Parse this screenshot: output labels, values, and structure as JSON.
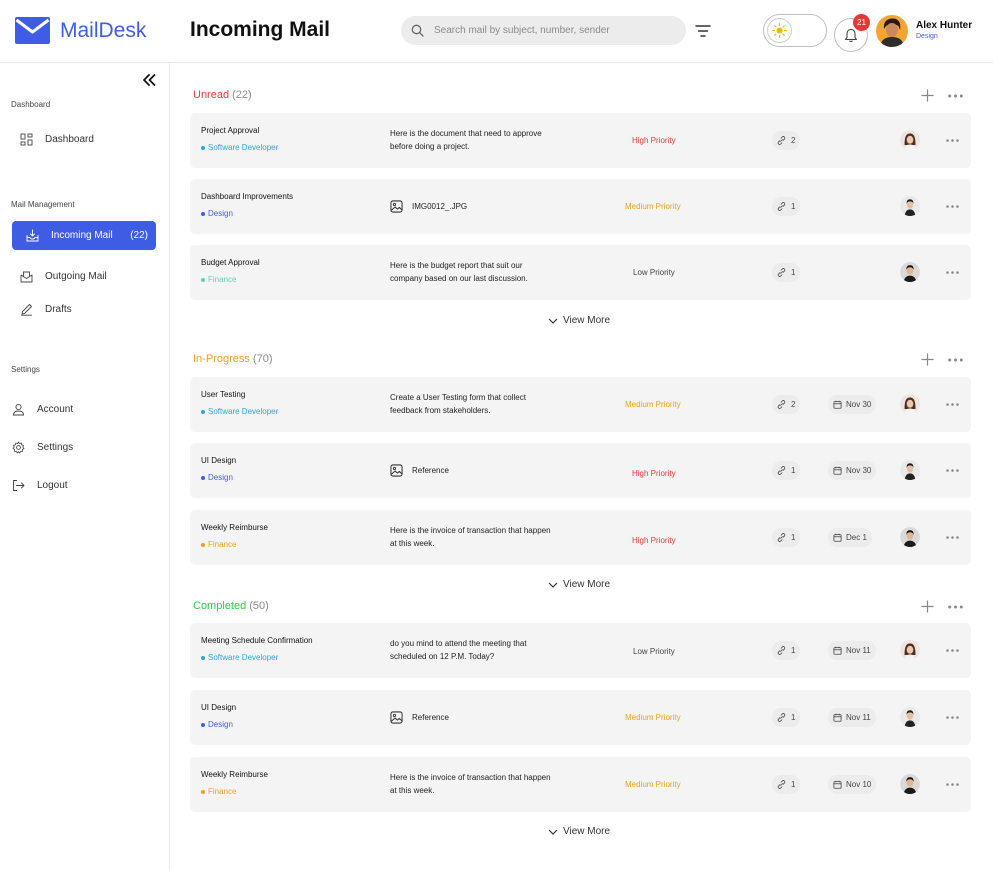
{
  "app": {
    "name": "MailDesk"
  },
  "header": {
    "title": "Incoming Mail",
    "search_placeholder": "Search mail by subject, number, sender",
    "notifications": "21",
    "user": {
      "name": "Alex Hunter",
      "role": "Design"
    }
  },
  "sidebar": {
    "sections": [
      {
        "label": "Dashboard"
      },
      {
        "label": "Mail Management"
      },
      {
        "label": "Settings"
      }
    ],
    "items": [
      {
        "label": "Dashboard"
      },
      {
        "label": "Incoming Mail",
        "count": "(22)"
      },
      {
        "label": "Outgoing Mail"
      },
      {
        "label": "Drafts"
      },
      {
        "label": "Account"
      },
      {
        "label": "Settings"
      },
      {
        "label": "Logout"
      }
    ]
  },
  "colors": {
    "accent": "#3f5de4",
    "unread": "#e53935",
    "in_progress": "#f0a020",
    "completed": "#2ecc40",
    "high_priority": "#e53935",
    "medium_priority": "#e8a317",
    "low_priority": "#444444",
    "tag_software": "#29a8e0",
    "tag_design": "#3f5de4",
    "tag_finance": "#f0a020",
    "tag_finance_light": "#5fd3b8"
  },
  "groups": [
    {
      "label": "Unread",
      "count": "(22)",
      "view_more": "View More",
      "mails": [
        {
          "title": "Project Approval",
          "tag": "Software Developer",
          "desc1": "Here is the document that need to approve",
          "desc2": "before doing a project.",
          "priority": "High Priority",
          "links": "2"
        },
        {
          "title": "Dashboard Improvements",
          "tag": "Design",
          "attachment": "IMG0012_.JPG",
          "priority": "Medium Priority",
          "links": "1"
        },
        {
          "title": "Budget Approval",
          "tag": "Finance",
          "desc1": "Here is the budget report that suit our",
          "desc2": "company based on our last discussion.",
          "priority": "Low Priority",
          "links": "1"
        }
      ]
    },
    {
      "label": "In-Progress",
      "count": "(70)",
      "view_more": "View More",
      "mails": [
        {
          "title": "User Testing",
          "tag": "Software Developer",
          "desc1": "Create a User Testing form that collect",
          "desc2": "feedback from stakeholders.",
          "priority": "Medium Priority",
          "links": "2",
          "date": "Nov 30"
        },
        {
          "title": "UI Design",
          "tag": "Design",
          "attachment": "Reference",
          "priority": "High Priority",
          "links": "1",
          "date": "Nov 30"
        },
        {
          "title": "Weekly Reimburse",
          "tag": "Finance",
          "desc1": "Here is the invoice of transaction that happen",
          "desc2": "at this week.",
          "priority": "High Priority",
          "links": "1",
          "date": "Dec 1"
        }
      ]
    },
    {
      "label": "Completed",
      "count": "(50)",
      "view_more": "View More",
      "mails": [
        {
          "title": "Meeting Schedule Confirmation",
          "tag": "Software Developer",
          "desc1": "do you mind to attend the meeting that",
          "desc2": "scheduled on 12 P.M. Today?",
          "priority": "Low Priority",
          "links": "1",
          "date": "Nov 11"
        },
        {
          "title": "UI Design",
          "tag": "Design",
          "attachment": "Reference",
          "priority": "Medium Priority",
          "links": "1",
          "date": "Nov 11"
        },
        {
          "title": "Weekly Reimburse",
          "tag": "Finance",
          "desc1": "Here is the invoice of transaction that happen",
          "desc2": "at this week.",
          "priority": "Medium Priority",
          "links": "1",
          "date": "Nov 10"
        }
      ]
    }
  ]
}
